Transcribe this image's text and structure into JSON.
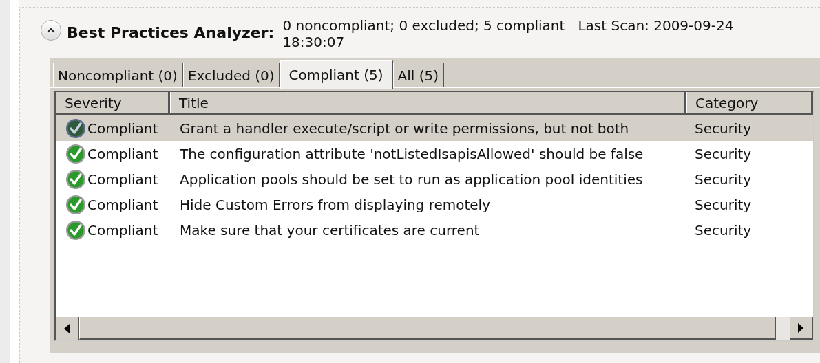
{
  "section": {
    "title": "Best Practices Analyzer:",
    "expanded": true,
    "summary": "0 noncompliant; 0 excluded; 5 compliant   Last Scan: 2009-09-24 18:30:07"
  },
  "tabs": [
    {
      "label": "Noncompliant (0)",
      "selected": false
    },
    {
      "label": "Excluded (0)",
      "selected": false
    },
    {
      "label": "Compliant (5)",
      "selected": true
    },
    {
      "label": "All (5)",
      "selected": false
    }
  ],
  "table": {
    "columns": [
      "Severity",
      "Title",
      "Category"
    ],
    "rows": [
      {
        "severity": "Compliant",
        "title": "Grant a handler execute/script or write permissions, but not both",
        "category": "Security",
        "selected": true
      },
      {
        "severity": "Compliant",
        "title": "The configuration attribute 'notListedIsapisAllowed' should be false",
        "category": "Security",
        "selected": false
      },
      {
        "severity": "Compliant",
        "title": "Application pools should be set to run as application pool identities",
        "category": "Security",
        "selected": false
      },
      {
        "severity": "Compliant",
        "title": "Hide Custom Errors from displaying remotely",
        "category": "Security",
        "selected": false
      },
      {
        "severity": "Compliant",
        "title": "Make sure that your certificates are current",
        "category": "Security",
        "selected": false
      }
    ]
  }
}
